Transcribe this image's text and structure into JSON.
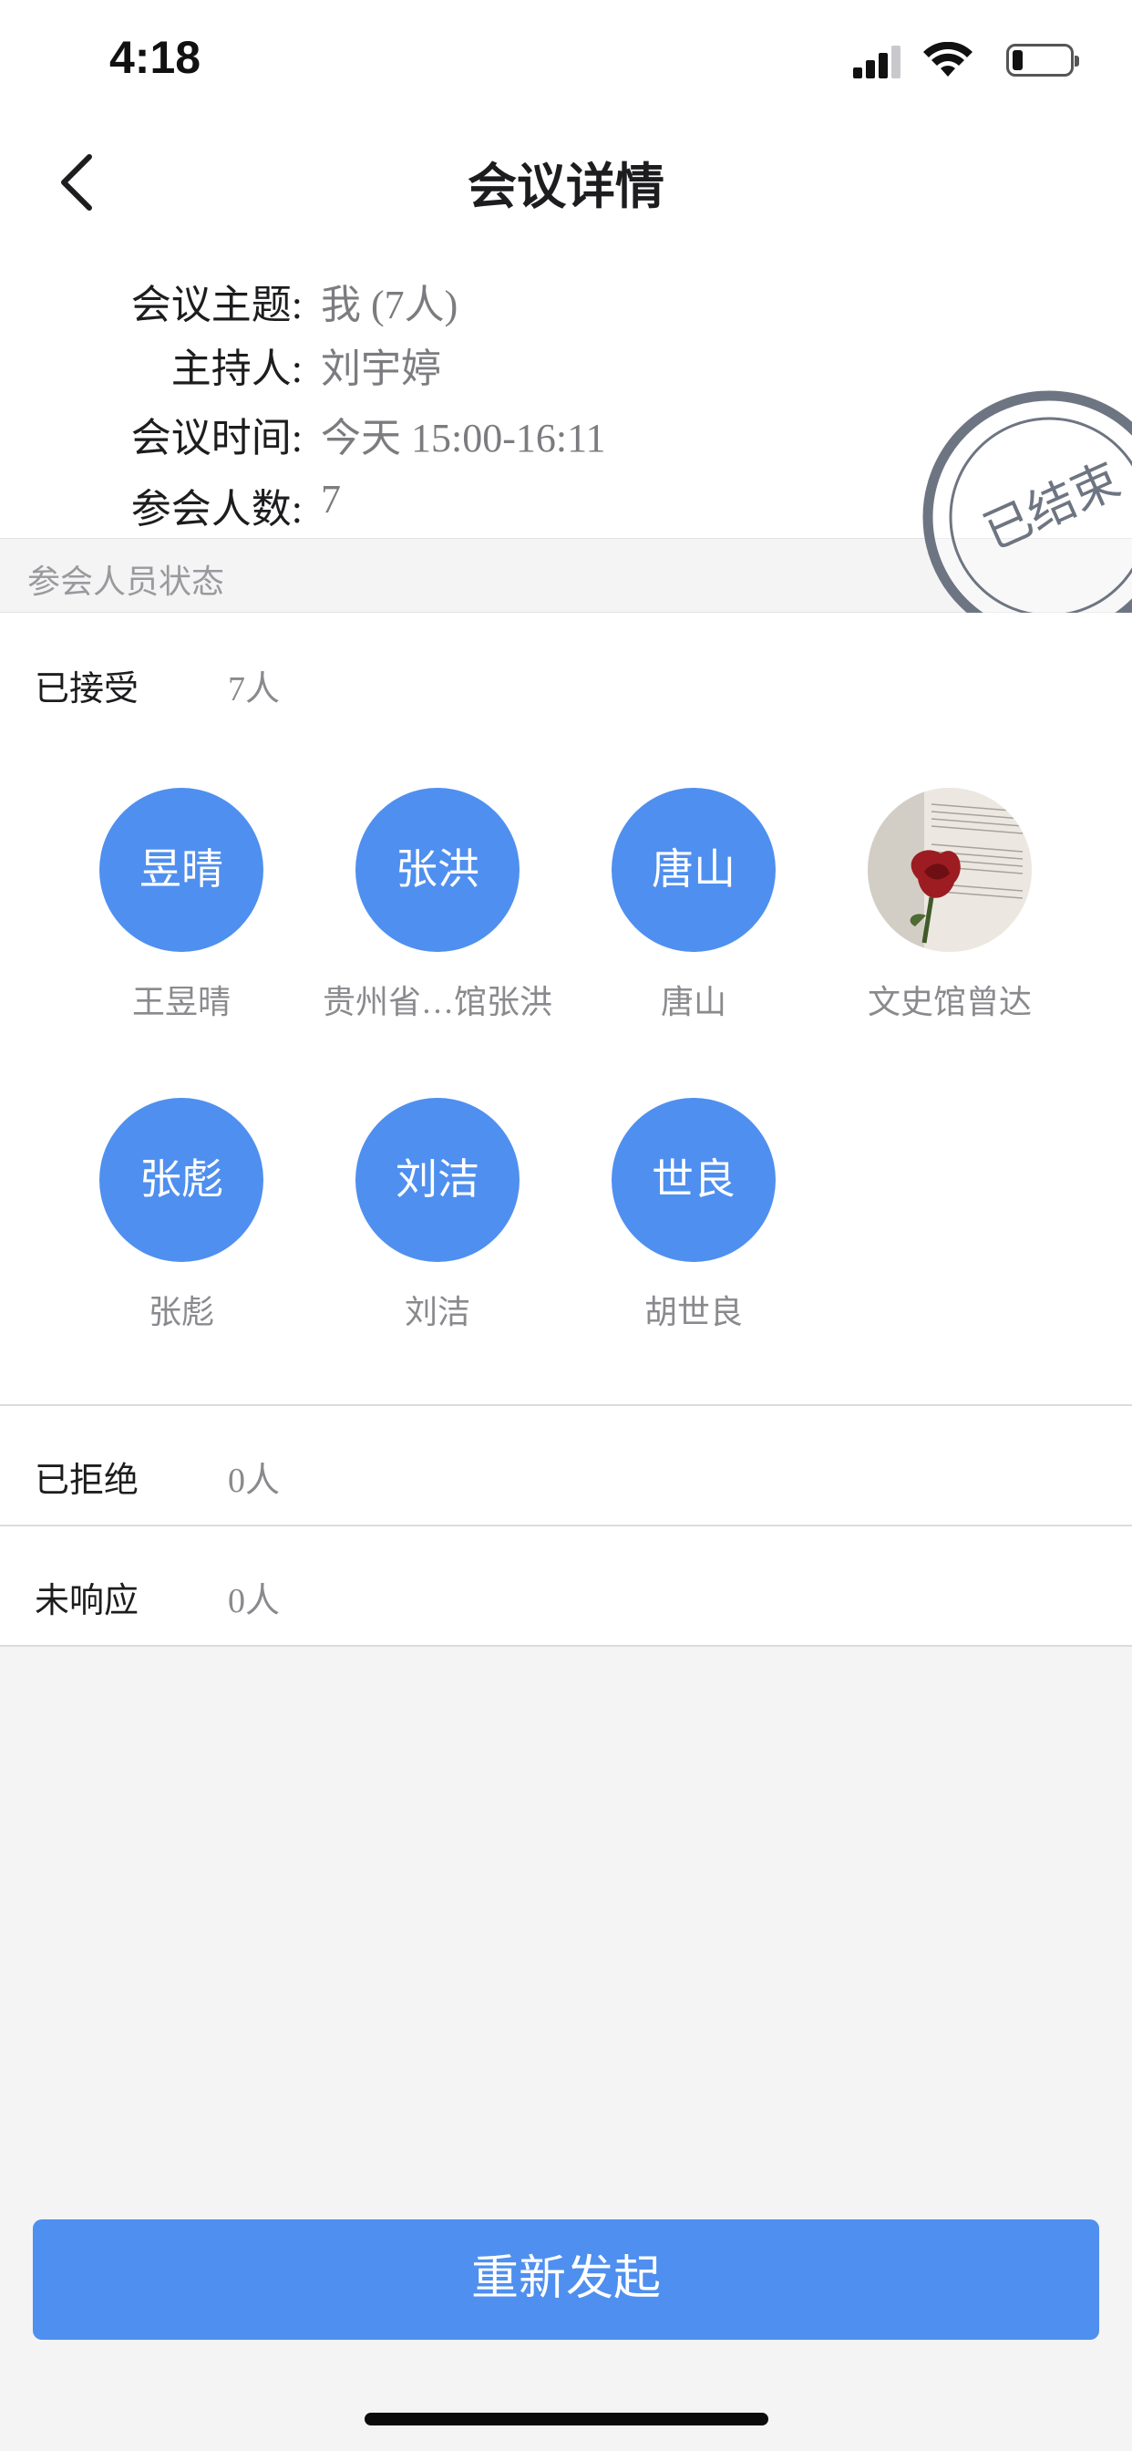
{
  "status_bar": {
    "time": "4:18"
  },
  "nav": {
    "title": "会议详情",
    "back_icon": "chevron-left-icon"
  },
  "meeting": {
    "topic_label": "会议主题:",
    "topic_value": "我 (7人)",
    "host_label": "主持人:",
    "host_value": "刘宇婷",
    "time_label": "会议时间:",
    "time_value": "今天  15:00-16:11",
    "count_label": "参会人数:",
    "count_value": "7",
    "stamp_text": "已结束"
  },
  "participants": {
    "section_title": "参会人员状态",
    "accepted": {
      "label": "已接受",
      "count": "7人",
      "members": [
        {
          "avatar_text": "昱晴",
          "name": "王昱晴"
        },
        {
          "avatar_text": "张洪",
          "name": "贵州省…馆张洪"
        },
        {
          "avatar_text": "唐山",
          "name": "唐山"
        },
        {
          "avatar_text": "",
          "name": "文史馆曾达",
          "avatar_image": "rose-photo"
        },
        {
          "avatar_text": "张彪",
          "name": "张彪"
        },
        {
          "avatar_text": "刘洁",
          "name": "刘洁"
        },
        {
          "avatar_text": "世良",
          "name": "胡世良"
        }
      ]
    },
    "rejected": {
      "label": "已拒绝",
      "count": "0人"
    },
    "no_response": {
      "label": "未响应",
      "count": "0人"
    }
  },
  "actions": {
    "relaunch_label": "重新发起"
  },
  "colors": {
    "accent": "#4f8fef",
    "background": "#f4f4f5",
    "muted_text": "#8a8a8e"
  }
}
